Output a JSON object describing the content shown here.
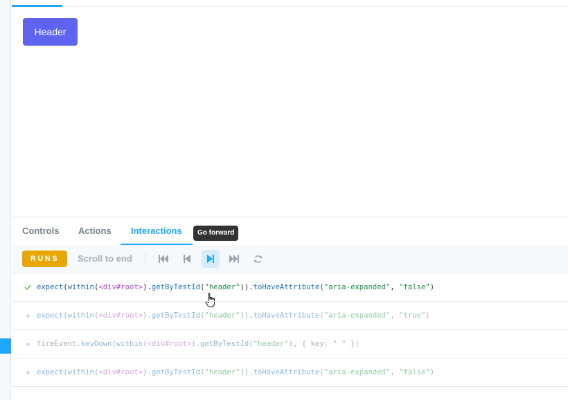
{
  "canvas": {
    "header_button": "Header"
  },
  "addons": {
    "tabs": [
      {
        "label": "Controls",
        "active": false
      },
      {
        "label": "Actions",
        "active": false
      },
      {
        "label": "Interactions",
        "active": true
      }
    ],
    "tooltip": "Go forward"
  },
  "toolbar": {
    "status_badge": "RUNS",
    "scroll_label": "Scroll to end",
    "controls": [
      "go-to-start-icon",
      "go-back-icon",
      "go-forward-icon",
      "go-to-end-icon",
      "rerun-icon"
    ]
  },
  "interactions": [
    {
      "status": "done",
      "parts": [
        [
          "fn",
          "expect"
        ],
        [
          "pun",
          "("
        ],
        [
          "fn",
          "within"
        ],
        [
          "pun",
          "("
        ],
        [
          "tag",
          "<div#root>"
        ],
        [
          "pun",
          ")."
        ],
        [
          "fn",
          "getByTestId"
        ],
        [
          "pun",
          "("
        ],
        [
          "str",
          "\"header\""
        ],
        [
          "pun",
          "))."
        ],
        [
          "fn",
          "toHaveAttribute"
        ],
        [
          "pun",
          "("
        ],
        [
          "str",
          "\"aria-expanded\""
        ],
        [
          "pun",
          ", "
        ],
        [
          "str",
          "\"false\""
        ],
        [
          "pun",
          ")"
        ]
      ]
    },
    {
      "status": "pending",
      "parts": [
        [
          "fn",
          "expect"
        ],
        [
          "pun",
          "("
        ],
        [
          "fn",
          "within"
        ],
        [
          "pun",
          "("
        ],
        [
          "tag",
          "<div#root>"
        ],
        [
          "pun",
          ")."
        ],
        [
          "fn",
          "getByTestId"
        ],
        [
          "pun",
          "("
        ],
        [
          "str",
          "\"header\""
        ],
        [
          "pun",
          "))."
        ],
        [
          "fn",
          "toHaveAttribute"
        ],
        [
          "pun",
          "("
        ],
        [
          "str",
          "\"aria-expanded\""
        ],
        [
          "pun",
          ", "
        ],
        [
          "str",
          "\"true\""
        ],
        [
          "pun",
          ")"
        ]
      ]
    },
    {
      "status": "pending",
      "parts": [
        [
          "pun",
          "fireEvent."
        ],
        [
          "fn",
          "keyDown"
        ],
        [
          "pun",
          "("
        ],
        [
          "fn",
          "within"
        ],
        [
          "pun",
          "("
        ],
        [
          "tag",
          "<div#root>"
        ],
        [
          "pun",
          ")."
        ],
        [
          "fn",
          "getByTestId"
        ],
        [
          "pun",
          "("
        ],
        [
          "str",
          "\"header\""
        ],
        [
          "pun",
          "), { key: "
        ],
        [
          "str",
          "\" \""
        ],
        [
          "pun",
          " })"
        ]
      ]
    },
    {
      "status": "pending",
      "parts": [
        [
          "fn",
          "expect"
        ],
        [
          "pun",
          "("
        ],
        [
          "fn",
          "within"
        ],
        [
          "pun",
          "("
        ],
        [
          "tag",
          "<div#root>"
        ],
        [
          "pun",
          ")."
        ],
        [
          "fn",
          "getByTestId"
        ],
        [
          "pun",
          "("
        ],
        [
          "str",
          "\"header\""
        ],
        [
          "pun",
          "))."
        ],
        [
          "fn",
          "toHaveAttribute"
        ],
        [
          "pun",
          "("
        ],
        [
          "str",
          "\"aria-expanded\""
        ],
        [
          "pun",
          ", "
        ],
        [
          "str",
          "\"false\""
        ],
        [
          "pun",
          ")"
        ]
      ]
    }
  ],
  "colors": {
    "accent": "#1ea7fd",
    "header_button": "#5f64f0",
    "runs_badge": "#e9a706",
    "success_check": "#66bf3c"
  }
}
